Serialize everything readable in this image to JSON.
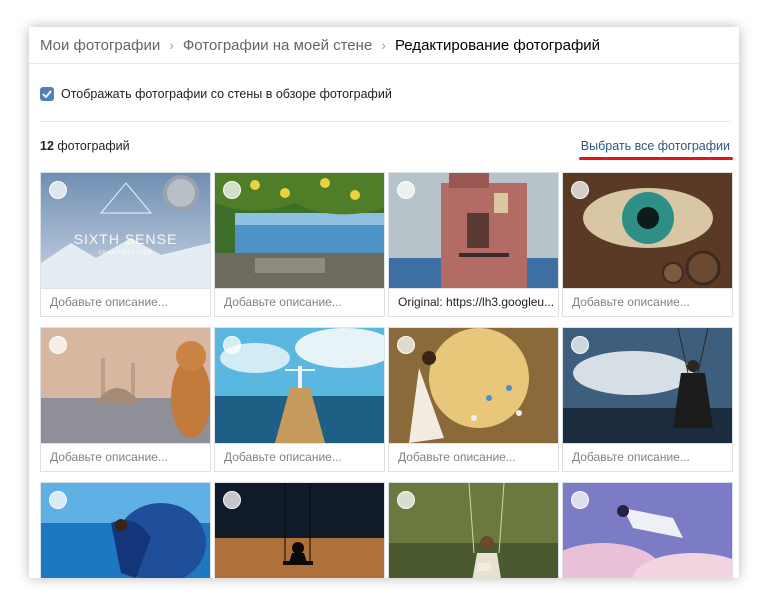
{
  "breadcrumb": {
    "items": [
      "Мои фотографии",
      "Фотографии на моей стене"
    ],
    "current": "Редактирование фотографий",
    "separator": "›"
  },
  "options": {
    "show_wall_photos_label": "Отображать фотографии со стены в обзоре фотографий",
    "show_wall_photos_checked": true
  },
  "album": {
    "count_number": "12",
    "count_word": "фотографий",
    "select_all_label": "Выбрать все фотографии"
  },
  "photos": [
    {
      "scene": "sixth-sense-cover",
      "caption": "Добавьте описание...",
      "overlay_title": "SIXTH SENSE",
      "overlay_sub": "GRADE SETTLER"
    },
    {
      "scene": "lemon-terrace-sea",
      "caption": "Добавьте описание..."
    },
    {
      "scene": "pink-house-sea",
      "caption": "Original: https://lh3.googleu..."
    },
    {
      "scene": "steampunk-eye",
      "caption": "Добавьте описание..."
    },
    {
      "scene": "cat-istanbul",
      "caption": "Добавьте описание..."
    },
    {
      "scene": "girl-on-pier",
      "caption": "Добавьте описание..."
    },
    {
      "scene": "girl-butterflies",
      "caption": "Добавьте описание..."
    },
    {
      "scene": "girl-swing-storm",
      "caption": "Добавьте описание..."
    },
    {
      "scene": "blue-dress-sea",
      "caption": ""
    },
    {
      "scene": "moon-swing-silhouette",
      "caption": ""
    },
    {
      "scene": "forest-girl-book",
      "caption": ""
    },
    {
      "scene": "floating-girl-clouds",
      "caption": ""
    }
  ],
  "colors": {
    "accent": "#5181b8",
    "link": "#2a5885",
    "highlight_underline": "#e1131c"
  }
}
